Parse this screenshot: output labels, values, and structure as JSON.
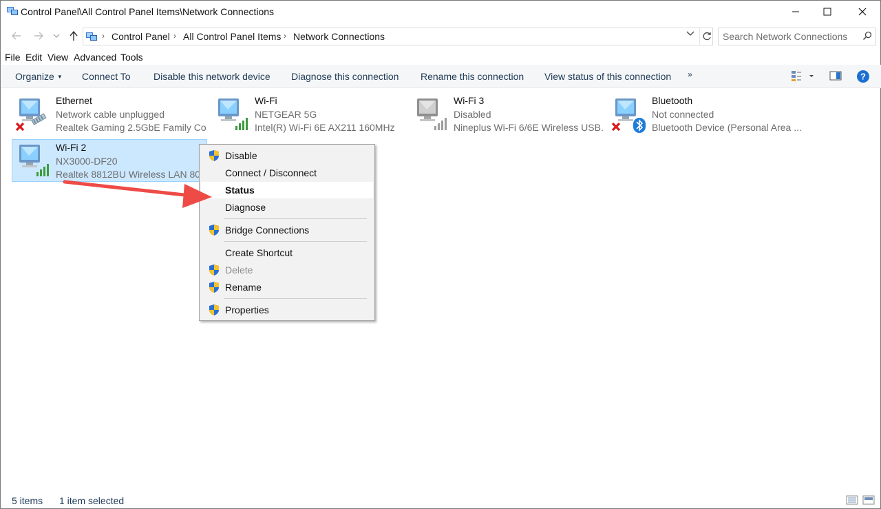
{
  "window": {
    "title": "Control Panel\\All Control Panel Items\\Network Connections"
  },
  "address": {
    "crumbs": [
      "Control Panel",
      "All Control Panel Items",
      "Network Connections"
    ],
    "search_placeholder": "Search Network Connections"
  },
  "menu": [
    "File",
    "Edit",
    "View",
    "Advanced",
    "Tools"
  ],
  "commands": {
    "organize": "Organize",
    "connect_to": "Connect To",
    "disable": "Disable this network device",
    "diagnose": "Diagnose this connection",
    "rename": "Rename this connection",
    "view_status": "View status of this connection",
    "more": "»"
  },
  "connections": [
    {
      "name": "Ethernet",
      "status": "Network cable unplugged",
      "device": "Realtek Gaming 2.5GbE Family Co...",
      "icon": "ethernet-disconnected-icon"
    },
    {
      "name": "Wi-Fi",
      "status": "NETGEAR 5G",
      "device": "Intel(R) Wi-Fi 6E AX211 160MHz",
      "icon": "wifi-connected-icon"
    },
    {
      "name": "Wi-Fi 3",
      "status": "Disabled",
      "device": "Nineplus Wi-Fi 6/6E Wireless USB...",
      "icon": "wifi-disabled-icon"
    },
    {
      "name": "Bluetooth",
      "status": "Not connected",
      "device": "Bluetooth Device (Personal Area ...",
      "icon": "bluetooth-disconnected-icon"
    },
    {
      "name": "Wi-Fi 2",
      "status": "NX3000-DF20",
      "device": "Realtek 8812BU Wireless LAN 802...",
      "icon": "wifi-connected-icon",
      "selected": true
    }
  ],
  "context_menu": [
    {
      "label": "Disable",
      "shield": true
    },
    {
      "label": "Connect / Disconnect",
      "shield": false
    },
    {
      "label": "Status",
      "shield": false,
      "bold": true,
      "highlighted": true
    },
    {
      "label": "Diagnose",
      "shield": false
    },
    {
      "label": "Bridge Connections",
      "shield": true
    },
    {
      "label": "Create Shortcut",
      "shield": false
    },
    {
      "label": "Delete",
      "shield": true,
      "disabled": true
    },
    {
      "label": "Rename",
      "shield": true
    },
    {
      "label": "Properties",
      "shield": true
    }
  ],
  "statusbar": {
    "items_count": "5 items",
    "selected": "1 item selected"
  },
  "colors": {
    "selection_bg": "#cce8ff",
    "selection_border": "#99d1ff",
    "annotation_arrow": "#ee4b46",
    "command_text": "#1e3956"
  }
}
